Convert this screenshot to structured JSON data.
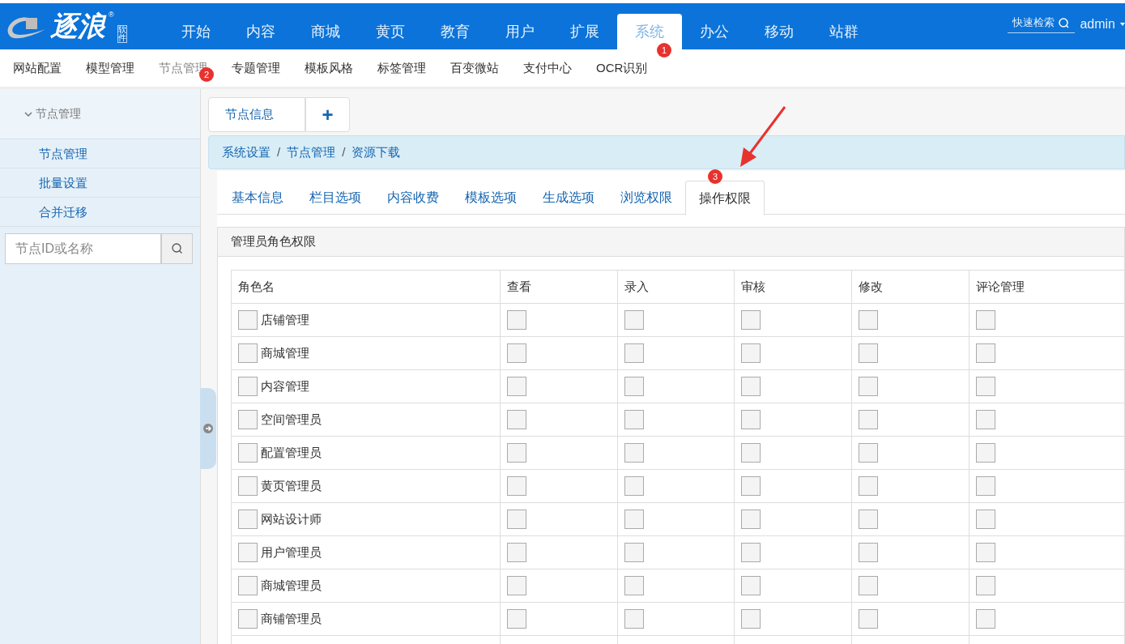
{
  "logo": {
    "text": "逐浪",
    "mark": "®",
    "tag": "软件"
  },
  "nav": [
    {
      "label": "开始",
      "selected": false
    },
    {
      "label": "内容",
      "selected": false
    },
    {
      "label": "商城",
      "selected": false
    },
    {
      "label": "黄页",
      "selected": false
    },
    {
      "label": "教育",
      "selected": false
    },
    {
      "label": "用户",
      "selected": false
    },
    {
      "label": "扩展",
      "selected": false
    },
    {
      "label": "系统",
      "selected": true,
      "marker": "1"
    },
    {
      "label": "办公",
      "selected": false
    },
    {
      "label": "移动",
      "selected": false
    },
    {
      "label": "站群",
      "selected": false
    }
  ],
  "quick_search": {
    "placeholder": "快速检索"
  },
  "user": {
    "name": "admin"
  },
  "subnav": [
    {
      "label": "网站配置",
      "selected": false
    },
    {
      "label": "模型管理",
      "selected": false
    },
    {
      "label": "节点管理",
      "selected": true,
      "marker": "2"
    },
    {
      "label": "专题管理",
      "selected": false
    },
    {
      "label": "模板风格",
      "selected": false
    },
    {
      "label": "标签管理",
      "selected": false
    },
    {
      "label": "百变微站",
      "selected": false
    },
    {
      "label": "支付中心",
      "selected": false
    },
    {
      "label": "OCR识别",
      "selected": false
    }
  ],
  "sidebar": {
    "group": {
      "label": "节点管理",
      "expanded": true
    },
    "items": [
      "节点管理",
      "批量设置",
      "合并迁移"
    ],
    "search": {
      "placeholder": "节点ID或名称"
    }
  },
  "page_tabs": [
    {
      "label": "节点信息"
    }
  ],
  "add_tab": "+",
  "breadcrumb": [
    "系统设置",
    "节点管理",
    "资源下载"
  ],
  "breadcrumb_separator": "/",
  "tabs": [
    {
      "label": "基本信息",
      "selected": false
    },
    {
      "label": "栏目选项",
      "selected": false
    },
    {
      "label": "内容收费",
      "selected": false
    },
    {
      "label": "模板选项",
      "selected": false
    },
    {
      "label": "生成选项",
      "selected": false
    },
    {
      "label": "浏览权限",
      "selected": false
    },
    {
      "label": "操作权限",
      "selected": true,
      "marker": "3"
    }
  ],
  "section": {
    "title": "管理员角色权限"
  },
  "table": {
    "columns": [
      "角色名",
      "查看",
      "录入",
      "审核",
      "修改",
      "评论管理"
    ],
    "rows": [
      {
        "name": "店铺管理",
        "checked": false,
        "permissions": [
          false,
          false,
          false,
          false,
          false
        ]
      },
      {
        "name": "商城管理",
        "checked": false,
        "permissions": [
          false,
          false,
          false,
          false,
          false
        ]
      },
      {
        "name": "内容管理",
        "checked": false,
        "permissions": [
          false,
          false,
          false,
          false,
          false
        ]
      },
      {
        "name": "空间管理员",
        "checked": false,
        "permissions": [
          false,
          false,
          false,
          false,
          false
        ]
      },
      {
        "name": "配置管理员",
        "checked": false,
        "permissions": [
          false,
          false,
          false,
          false,
          false
        ]
      },
      {
        "name": "黄页管理员",
        "checked": false,
        "permissions": [
          false,
          false,
          false,
          false,
          false
        ]
      },
      {
        "name": "网站设计师",
        "checked": false,
        "permissions": [
          false,
          false,
          false,
          false,
          false
        ]
      },
      {
        "name": "用户管理员",
        "checked": false,
        "permissions": [
          false,
          false,
          false,
          false,
          false
        ]
      },
      {
        "name": "商城管理员",
        "checked": false,
        "permissions": [
          false,
          false,
          false,
          false,
          false
        ]
      },
      {
        "name": "商铺管理员",
        "checked": false,
        "permissions": [
          false,
          false,
          false,
          false,
          false
        ]
      }
    ]
  }
}
